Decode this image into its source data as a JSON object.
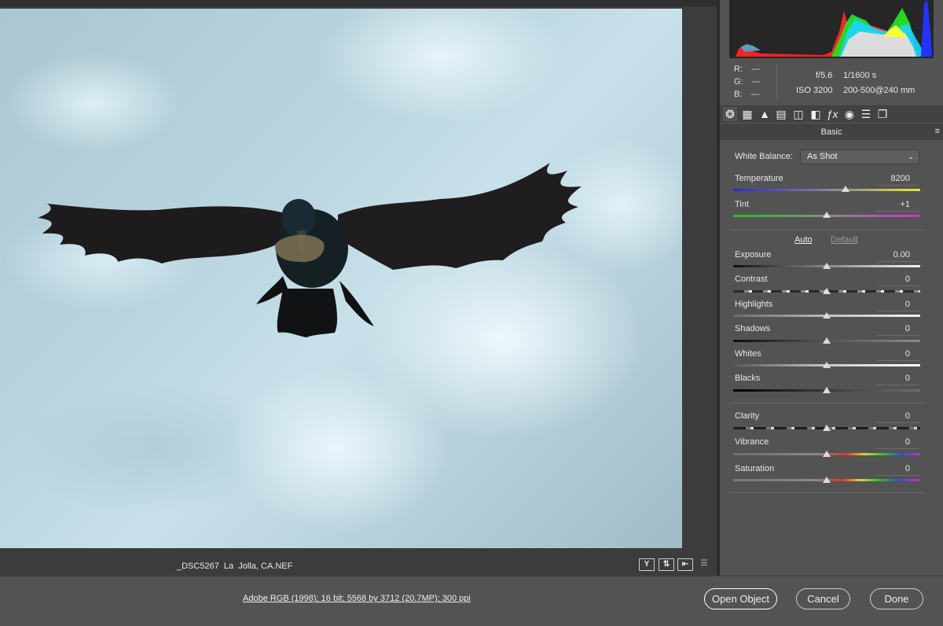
{
  "image": {
    "filename": "_DSC5267  La  Jolla, CA.NEF"
  },
  "info": {
    "r_label": "R:",
    "r_value": "---",
    "g_label": "G:",
    "g_value": "---",
    "b_label": "B:",
    "b_value": "---",
    "aperture": "f/5.6",
    "shutter": "1/1600 s",
    "iso": "ISO 3200",
    "lens": "200-500@240 mm"
  },
  "tabs": [
    {
      "icon": "basic-aperture-icon",
      "glyph": "❂",
      "active": true
    },
    {
      "icon": "tone-curve-icon",
      "glyph": "▦"
    },
    {
      "icon": "detail-icon",
      "glyph": "▲"
    },
    {
      "icon": "hsl-icon",
      "glyph": "▤"
    },
    {
      "icon": "split-toning-icon",
      "glyph": "◫"
    },
    {
      "icon": "lens-corrections-icon",
      "glyph": "◧"
    },
    {
      "icon": "effects-fx-icon",
      "glyph": "ƒx"
    },
    {
      "icon": "camera-calibration-icon",
      "glyph": "◉"
    },
    {
      "icon": "presets-icon",
      "glyph": "☰"
    },
    {
      "icon": "snapshots-icon",
      "glyph": "❐"
    }
  ],
  "panel": {
    "title": "Basic",
    "menu_glyph": "≡"
  },
  "white_balance": {
    "label": "White Balance:",
    "value": "As Shot"
  },
  "auto_label": "Auto",
  "default_label": "Default",
  "sliders": [
    {
      "key": "temperature",
      "label": "Temperature",
      "value": "8200",
      "position": 0.6
    },
    {
      "key": "tint",
      "label": "Tint",
      "value": "+1",
      "position": 0.5
    },
    {
      "key": "exposure",
      "label": "Exposure",
      "value": "0.00",
      "position": 0.5
    },
    {
      "key": "contrast",
      "label": "Contrast",
      "value": "0",
      "position": 0.5
    },
    {
      "key": "highlights",
      "label": "Highlights",
      "value": "0",
      "position": 0.5
    },
    {
      "key": "shadows",
      "label": "Shadows",
      "value": "0",
      "position": 0.5
    },
    {
      "key": "whites",
      "label": "Whites",
      "value": "0",
      "position": 0.5
    },
    {
      "key": "blacks",
      "label": "Blacks",
      "value": "0",
      "position": 0.5
    },
    {
      "key": "clarity",
      "label": "Clarity",
      "value": "0",
      "position": 0.5
    },
    {
      "key": "vibrance",
      "label": "Vibrance",
      "value": "0",
      "position": 0.5
    },
    {
      "key": "saturation",
      "label": "Saturation",
      "value": "0",
      "position": 0.5
    }
  ],
  "footer": {
    "workflow": "Adobe RGB (1998); 16 bit; 5568 by 3712 (20.7MP); 300 ppi",
    "open_object": "Open Object",
    "cancel": "Cancel",
    "done": "Done"
  },
  "view_buttons": [
    {
      "icon": "before-after-icon",
      "glyph": "Y"
    },
    {
      "icon": "swap-settings-icon",
      "glyph": "⇅"
    },
    {
      "icon": "copy-settings-icon",
      "glyph": "⇤"
    },
    {
      "icon": "toggle-settings-icon",
      "glyph": "☰"
    }
  ],
  "colors": {
    "panel_bg": "#535353",
    "accent_link": "#e8e8e8"
  }
}
